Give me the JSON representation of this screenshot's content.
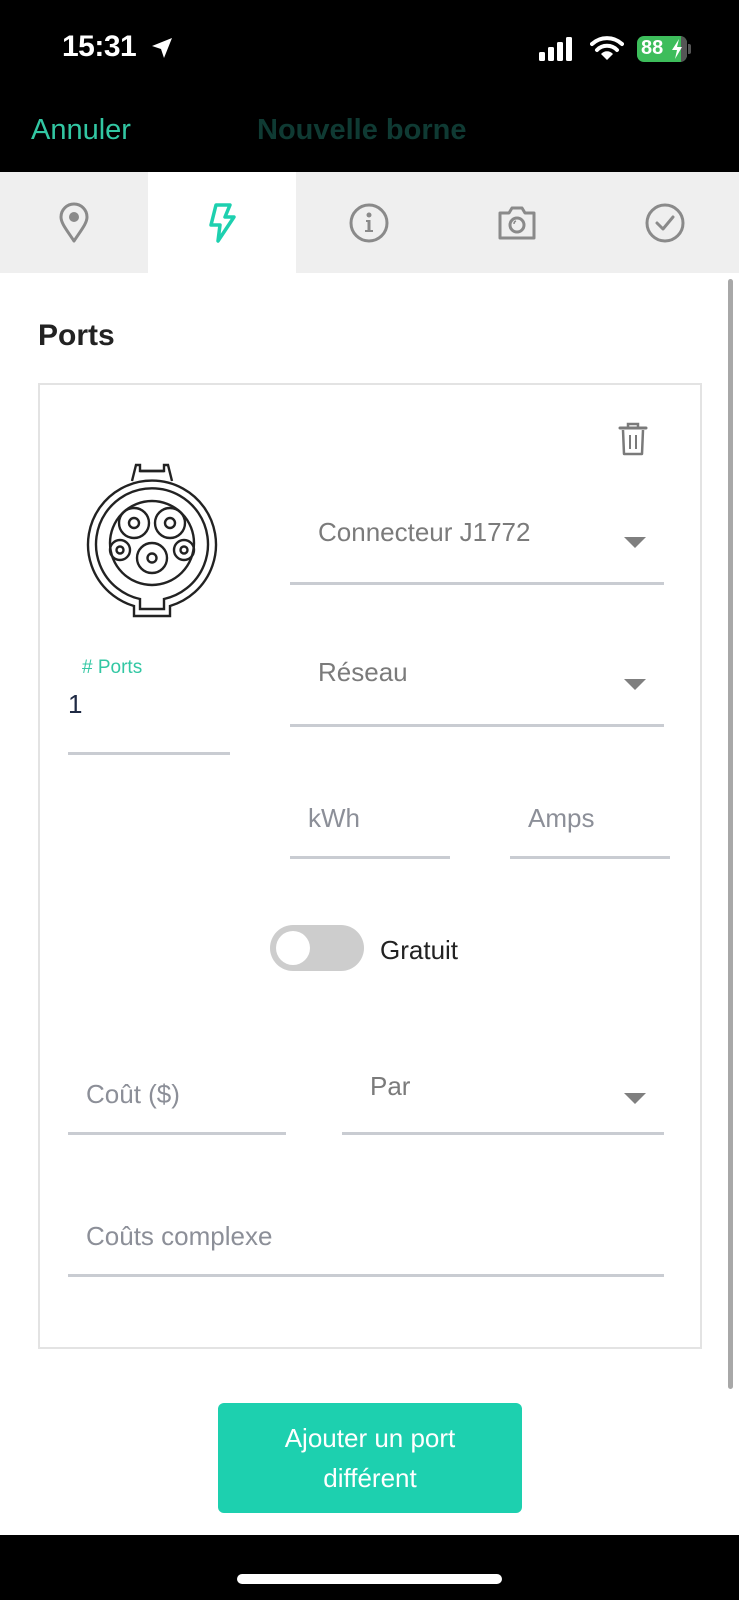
{
  "status_bar": {
    "time": "15:31",
    "battery_percent": "88",
    "icons": [
      "location-arrow-icon",
      "signal-icon",
      "wifi-icon",
      "battery-charging-icon"
    ]
  },
  "nav": {
    "cancel_label": "Annuler",
    "title": "Nouvelle borne"
  },
  "tabs": [
    {
      "name": "location",
      "icon": "map-pin-icon",
      "active": false
    },
    {
      "name": "power",
      "icon": "lightning-icon",
      "active": true
    },
    {
      "name": "info",
      "icon": "info-icon",
      "active": false
    },
    {
      "name": "photo",
      "icon": "camera-icon",
      "active": false
    },
    {
      "name": "confirm",
      "icon": "check-circle-icon",
      "active": false
    }
  ],
  "colors": {
    "accent": "#1dd0af",
    "accent_text": "#32c7a3",
    "tab_inactive": "#8a8a8a",
    "field_underline": "#c9ccd2"
  },
  "section": {
    "title": "Ports"
  },
  "port_card": {
    "connector": {
      "value": "Connecteur J1772"
    },
    "network": {
      "value": "Réseau"
    },
    "ports": {
      "label": "# Ports",
      "value": "1"
    },
    "kwh": {
      "placeholder": "kWh"
    },
    "amps": {
      "placeholder": "Amps"
    },
    "free_toggle": {
      "label": "Gratuit",
      "on": false
    },
    "cost": {
      "placeholder": "Coût ($)"
    },
    "per": {
      "value": "Par"
    },
    "complex_cost": {
      "placeholder": "Coûts complexe"
    }
  },
  "add_port_button": {
    "label": "Ajouter un port différent"
  }
}
